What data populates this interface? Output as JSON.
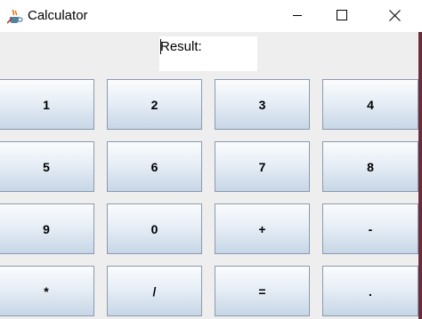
{
  "window": {
    "title": "Calculator",
    "icon": "java-coffee-cup-icon",
    "controls": [
      "minimize-icon",
      "maximize-icon",
      "close-icon"
    ]
  },
  "result": {
    "label": "Result:",
    "value": ""
  },
  "keys": [
    {
      "label": "1"
    },
    {
      "label": "2"
    },
    {
      "label": "3"
    },
    {
      "label": "4"
    },
    {
      "label": "5"
    },
    {
      "label": "6"
    },
    {
      "label": "7"
    },
    {
      "label": "8"
    },
    {
      "label": "9"
    },
    {
      "label": "0"
    },
    {
      "label": "+"
    },
    {
      "label": "-"
    },
    {
      "label": "*"
    },
    {
      "label": "/"
    },
    {
      "label": "="
    },
    {
      "label": "."
    }
  ],
  "colors": {
    "key_border": "#8a9bb0",
    "key_gradient_top": "#fbfcfd",
    "key_gradient_bottom": "#c7d6e6",
    "panel_background": "#eeeeee"
  }
}
